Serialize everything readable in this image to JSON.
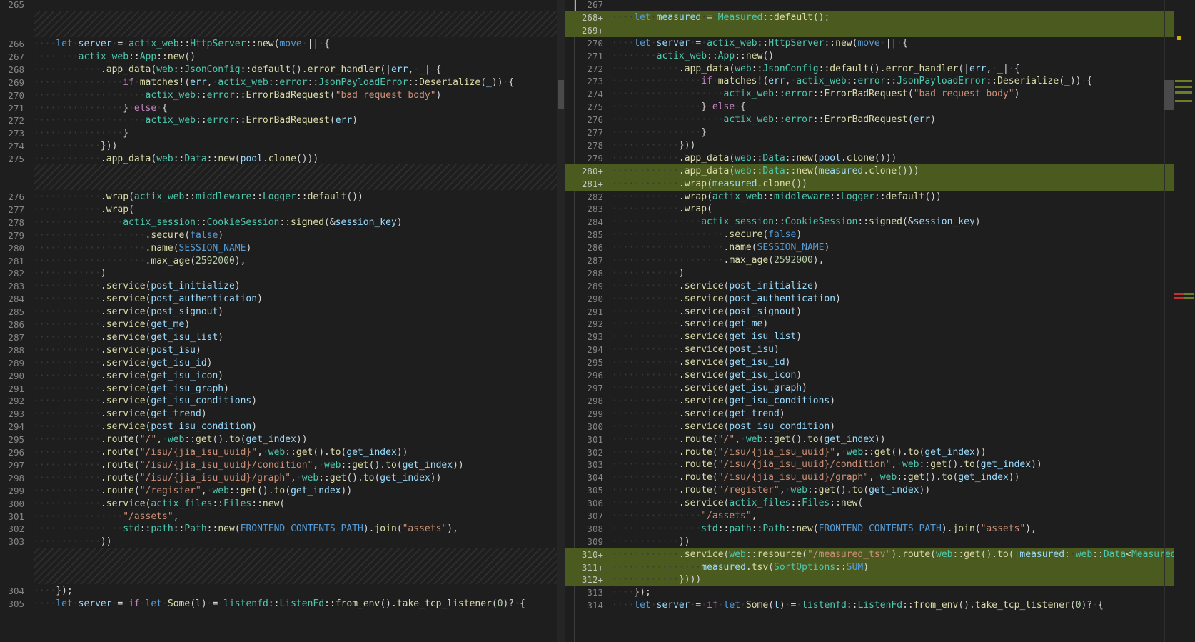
{
  "colors": {
    "background": "#1e1e1e",
    "added_line": "#4b5a1f",
    "line_number": "#858585",
    "keyword": "#569cd6",
    "type": "#4ec9b0",
    "function": "#dcdcaa",
    "string": "#ce9178",
    "variable": "#9cdcfe",
    "number": "#b5cea8",
    "control": "#c586c0",
    "whitespace_dot": "#3a3a3a"
  },
  "left": {
    "lines": [
      {
        "n": "265",
        "t": ""
      },
      {
        "n": "266",
        "t": "    let server = actix_web::HttpServer::new(move || {"
      },
      {
        "n": "267",
        "t": "        actix_web::App::new()"
      },
      {
        "n": "268",
        "t": "            .app_data(web::JsonConfig::default().error_handler(|err, _| {"
      },
      {
        "n": "269",
        "t": "                if matches!(err, actix_web::error::JsonPayloadError::Deserialize(_)) {"
      },
      {
        "n": "270",
        "t": "                    actix_web::error::ErrorBadRequest(\"bad request body\")"
      },
      {
        "n": "271",
        "t": "                } else {"
      },
      {
        "n": "272",
        "t": "                    actix_web::error::ErrorBadRequest(err)"
      },
      {
        "n": "273",
        "t": "                }"
      },
      {
        "n": "274",
        "t": "            }))"
      },
      {
        "n": "275",
        "t": "            .app_data(web::Data::new(pool.clone()))"
      },
      {
        "n": "276",
        "t": "            .wrap(actix_web::middleware::Logger::default())"
      },
      {
        "n": "277",
        "t": "            .wrap("
      },
      {
        "n": "278",
        "t": "                actix_session::CookieSession::signed(&session_key)"
      },
      {
        "n": "279",
        "t": "                    .secure(false)"
      },
      {
        "n": "280",
        "t": "                    .name(SESSION_NAME)"
      },
      {
        "n": "281",
        "t": "                    .max_age(2592000),"
      },
      {
        "n": "282",
        "t": "            )"
      },
      {
        "n": "283",
        "t": "            .service(post_initialize)"
      },
      {
        "n": "284",
        "t": "            .service(post_authentication)"
      },
      {
        "n": "285",
        "t": "            .service(post_signout)"
      },
      {
        "n": "286",
        "t": "            .service(get_me)"
      },
      {
        "n": "287",
        "t": "            .service(get_isu_list)"
      },
      {
        "n": "288",
        "t": "            .service(post_isu)"
      },
      {
        "n": "289",
        "t": "            .service(get_isu_id)"
      },
      {
        "n": "290",
        "t": "            .service(get_isu_icon)"
      },
      {
        "n": "291",
        "t": "            .service(get_isu_graph)"
      },
      {
        "n": "292",
        "t": "            .service(get_isu_conditions)"
      },
      {
        "n": "293",
        "t": "            .service(get_trend)"
      },
      {
        "n": "294",
        "t": "            .service(post_isu_condition)"
      },
      {
        "n": "295",
        "t": "            .route(\"/\", web::get().to(get_index))"
      },
      {
        "n": "296",
        "t": "            .route(\"/isu/{jia_isu_uuid}\", web::get().to(get_index))"
      },
      {
        "n": "297",
        "t": "            .route(\"/isu/{jia_isu_uuid}/condition\", web::get().to(get_index))"
      },
      {
        "n": "298",
        "t": "            .route(\"/isu/{jia_isu_uuid}/graph\", web::get().to(get_index))"
      },
      {
        "n": "299",
        "t": "            .route(\"/register\", web::get().to(get_index))"
      },
      {
        "n": "300",
        "t": "            .service(actix_files::Files::new("
      },
      {
        "n": "301",
        "t": "                \"/assets\","
      },
      {
        "n": "302",
        "t": "                std::path::Path::new(FRONTEND_CONTENTS_PATH).join(\"assets\"),"
      },
      {
        "n": "303",
        "t": "            ))"
      },
      {
        "n": "304",
        "t": "    });"
      },
      {
        "n": "305",
        "t": "    let server = if let Some(l) = listenfd::ListenFd::from_env().take_tcp_listener(0)? {"
      }
    ]
  },
  "right": {
    "lines": [
      {
        "n": "267",
        "t": ""
      },
      {
        "n": "268+",
        "t": "    let measured = Measured::default();"
      },
      {
        "n": "269+",
        "t": ""
      },
      {
        "n": "270",
        "t": "    let server = actix_web::HttpServer::new(move || {"
      },
      {
        "n": "271",
        "t": "        actix_web::App::new()"
      },
      {
        "n": "272",
        "t": "            .app_data(web::JsonConfig::default().error_handler(|err, _| {"
      },
      {
        "n": "273",
        "t": "                if matches!(err, actix_web::error::JsonPayloadError::Deserialize(_)) {"
      },
      {
        "n": "274",
        "t": "                    actix_web::error::ErrorBadRequest(\"bad request body\")"
      },
      {
        "n": "275",
        "t": "                } else {"
      },
      {
        "n": "276",
        "t": "                    actix_web::error::ErrorBadRequest(err)"
      },
      {
        "n": "277",
        "t": "                }"
      },
      {
        "n": "278",
        "t": "            }))"
      },
      {
        "n": "279",
        "t": "            .app_data(web::Data::new(pool.clone()))"
      },
      {
        "n": "280+",
        "t": "            .app_data(web::Data::new(measured.clone()))"
      },
      {
        "n": "281+",
        "t": "            .wrap(measured.clone())"
      },
      {
        "n": "282",
        "t": "            .wrap(actix_web::middleware::Logger::default())"
      },
      {
        "n": "283",
        "t": "            .wrap("
      },
      {
        "n": "284",
        "t": "                actix_session::CookieSession::signed(&session_key)"
      },
      {
        "n": "285",
        "t": "                    .secure(false)"
      },
      {
        "n": "286",
        "t": "                    .name(SESSION_NAME)"
      },
      {
        "n": "287",
        "t": "                    .max_age(2592000),"
      },
      {
        "n": "288",
        "t": "            )"
      },
      {
        "n": "289",
        "t": "            .service(post_initialize)"
      },
      {
        "n": "290",
        "t": "            .service(post_authentication)"
      },
      {
        "n": "291",
        "t": "            .service(post_signout)"
      },
      {
        "n": "292",
        "t": "            .service(get_me)"
      },
      {
        "n": "293",
        "t": "            .service(get_isu_list)"
      },
      {
        "n": "294",
        "t": "            .service(post_isu)"
      },
      {
        "n": "295",
        "t": "            .service(get_isu_id)"
      },
      {
        "n": "296",
        "t": "            .service(get_isu_icon)"
      },
      {
        "n": "297",
        "t": "            .service(get_isu_graph)"
      },
      {
        "n": "298",
        "t": "            .service(get_isu_conditions)"
      },
      {
        "n": "299",
        "t": "            .service(get_trend)"
      },
      {
        "n": "300",
        "t": "            .service(post_isu_condition)"
      },
      {
        "n": "301",
        "t": "            .route(\"/\", web::get().to(get_index))"
      },
      {
        "n": "302",
        "t": "            .route(\"/isu/{jia_isu_uuid}\", web::get().to(get_index))"
      },
      {
        "n": "303",
        "t": "            .route(\"/isu/{jia_isu_uuid}/condition\", web::get().to(get_index))"
      },
      {
        "n": "304",
        "t": "            .route(\"/isu/{jia_isu_uuid}/graph\", web::get().to(get_index))"
      },
      {
        "n": "305",
        "t": "            .route(\"/register\", web::get().to(get_index))"
      },
      {
        "n": "306",
        "t": "            .service(actix_files::Files::new("
      },
      {
        "n": "307",
        "t": "                \"/assets\","
      },
      {
        "n": "308",
        "t": "                std::path::Path::new(FRONTEND_CONTENTS_PATH).join(\"assets\"),"
      },
      {
        "n": "309",
        "t": "            ))"
      },
      {
        "n": "310+",
        "t": "            .service(web::resource(\"/measured_tsv\").route(web::get().to(|measured: web::Data<Measured>|"
      },
      {
        "n": "311+",
        "t": "                measured.tsv(SortOptions::SUM)"
      },
      {
        "n": "312+",
        "t": "            })))"
      },
      {
        "n": "313",
        "t": "    });"
      },
      {
        "n": "314",
        "t": "    let server = if let Some(l) = listenfd::ListenFd::from_env().take_tcp_listener(0)? {"
      }
    ]
  }
}
